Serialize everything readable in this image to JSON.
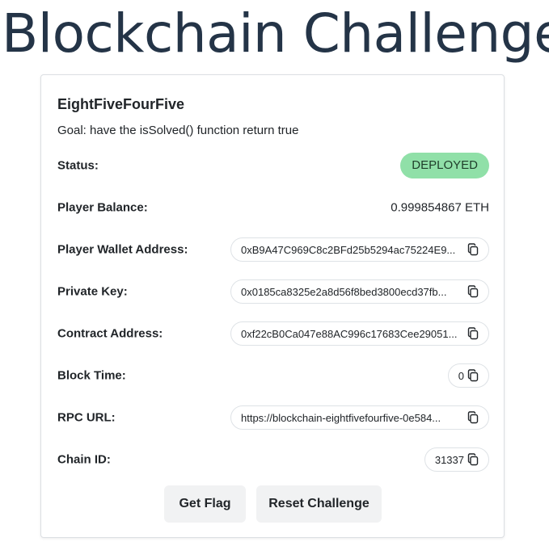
{
  "page": {
    "title": "Blockchain Challenge"
  },
  "challenge": {
    "name": "EightFiveFourFive",
    "goal": "Goal: have the isSolved() function return true"
  },
  "fields": {
    "status": {
      "label": "Status:",
      "value": "DEPLOYED"
    },
    "balance": {
      "label": "Player Balance:",
      "value": "0.999854867 ETH"
    },
    "wallet": {
      "label": "Player Wallet Address:",
      "value": "0xB9A47C969C8c2BFd25b5294ac75224E9..."
    },
    "private_key": {
      "label": "Private Key:",
      "value": "0x0185ca8325e2a8d56f8bed3800ecd37fb..."
    },
    "contract": {
      "label": "Contract Address:",
      "value": "0xf22cB0Ca047e88AC996c17683Cee29051..."
    },
    "block_time": {
      "label": "Block Time:",
      "value": "0"
    },
    "rpc_url": {
      "label": "RPC URL:",
      "value": "https://blockchain-eightfivefourfive-0e584..."
    },
    "chain_id": {
      "label": "Chain ID:",
      "value": "31337"
    }
  },
  "buttons": {
    "get_flag": "Get Flag",
    "reset": "Reset Challenge"
  },
  "icons": {
    "copy": "copy-icon"
  },
  "colors": {
    "title": "#243447",
    "status_badge_bg": "#90e0a8",
    "button_bg": "#f1f2f3"
  }
}
